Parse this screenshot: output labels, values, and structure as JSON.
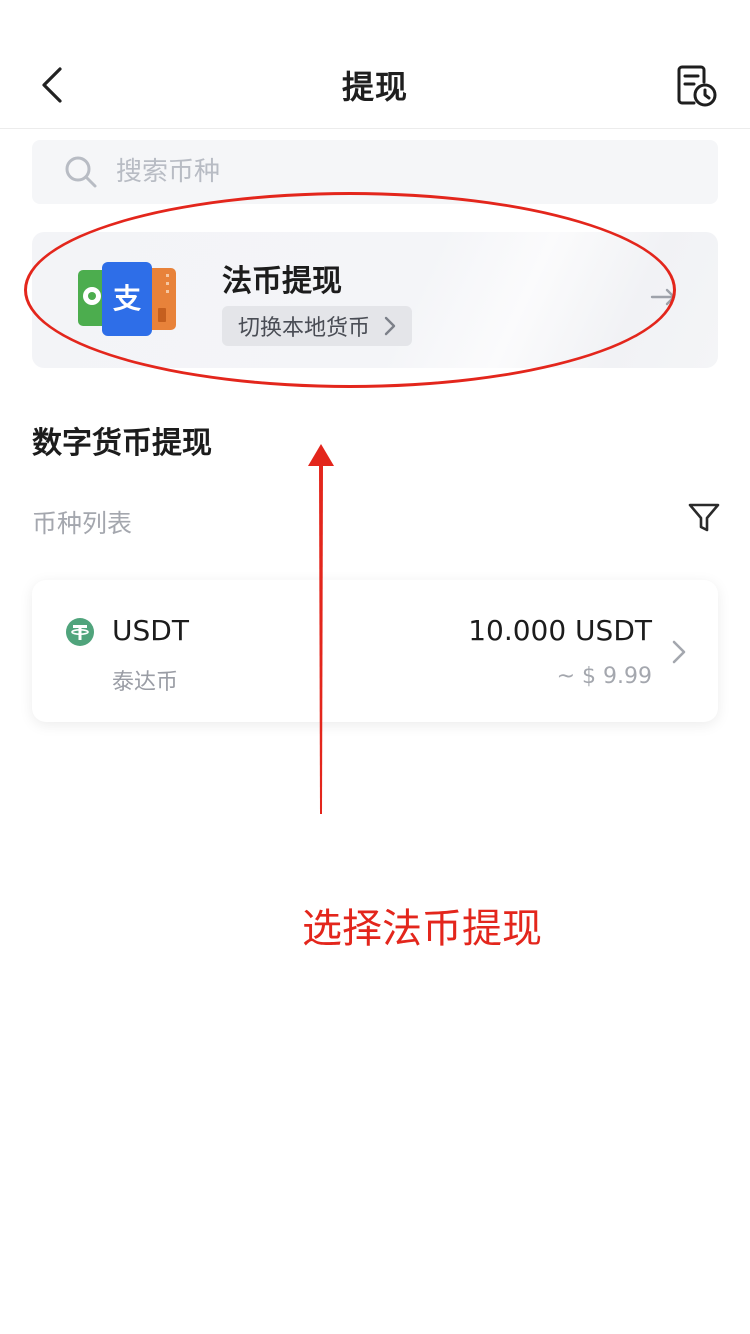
{
  "header": {
    "title": "提现",
    "back_icon": "chevron-left-icon",
    "records_icon": "document-clock-icon"
  },
  "search": {
    "placeholder": "搜索币种",
    "value": "",
    "icon": "search-icon"
  },
  "fiat_withdraw": {
    "title": "法币提现",
    "switch_label": "切换本地货币",
    "icon": "payment-wallets-icon"
  },
  "crypto_section": {
    "title": "数字货币提现",
    "list_label": "币种列表",
    "filter_icon": "filter-icon"
  },
  "coins": [
    {
      "symbol": "USDT",
      "name": "泰达币",
      "amount": "10.000 USDT",
      "fiat_value": "~ $ 9.99",
      "icon": "tether-icon"
    }
  ],
  "annotation": {
    "text": "选择法币提现",
    "color": "#e3261c"
  }
}
